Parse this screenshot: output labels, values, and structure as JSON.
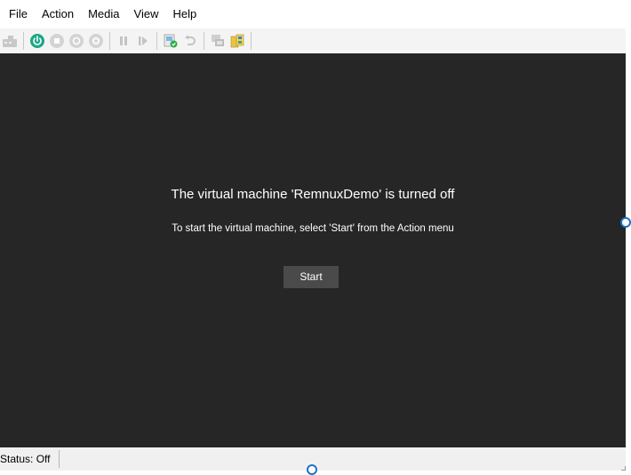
{
  "menubar": {
    "items": [
      {
        "label": "File"
      },
      {
        "label": "Action"
      },
      {
        "label": "Media"
      },
      {
        "label": "View"
      },
      {
        "label": "Help"
      }
    ]
  },
  "toolbar": {
    "buttons": [
      {
        "icon": "ctrl-alt-del-icon",
        "state": "disabled"
      },
      {
        "icon": "start-icon",
        "state": "enabled",
        "color": "#1aa886"
      },
      {
        "icon": "turn-off-icon",
        "state": "disabled"
      },
      {
        "icon": "shut-down-icon",
        "state": "disabled"
      },
      {
        "icon": "save-icon",
        "state": "disabled"
      },
      {
        "icon": "pause-icon",
        "state": "disabled"
      },
      {
        "icon": "resume-icon",
        "state": "disabled"
      },
      {
        "icon": "checkpoint-icon",
        "state": "enabled"
      },
      {
        "icon": "revert-icon",
        "state": "disabled"
      },
      {
        "icon": "enhanced-session-icon",
        "state": "disabled"
      },
      {
        "icon": "share-icon",
        "state": "enabled"
      }
    ]
  },
  "vm": {
    "message_title": "The virtual machine 'RemnuxDemo' is turned off",
    "message_detail": "To start the virtual machine, select 'Start' from the Action menu",
    "start_label": "Start",
    "background": "#262626"
  },
  "statusbar": {
    "status_text": "Status: Off"
  },
  "colors": {
    "accent": "#1b74c4",
    "start_green": "#1aa886"
  }
}
